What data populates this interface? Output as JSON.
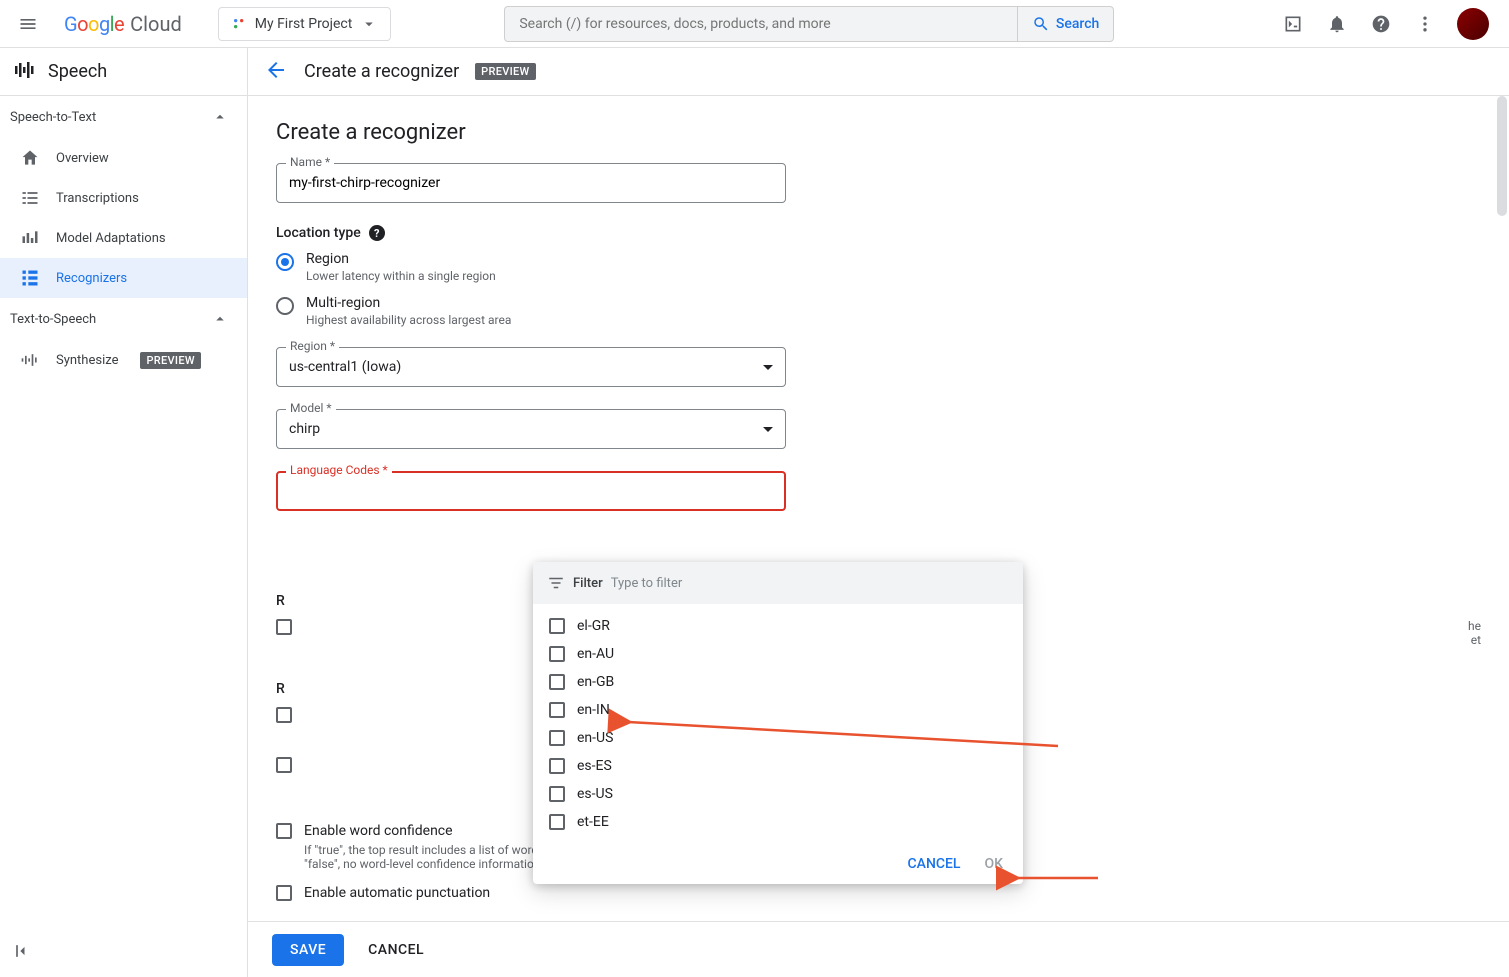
{
  "topbar": {
    "logo_text": "Google",
    "logo_cloud": "Cloud",
    "project_name": "My First Project",
    "search_placeholder": "Search (/) for resources, docs, products, and more",
    "search_button": "Search"
  },
  "product": {
    "name": "Speech",
    "page_title": "Create a recognizer",
    "badge": "PREVIEW"
  },
  "sidebar": {
    "groups": [
      {
        "label": "Speech-to-Text",
        "items": [
          {
            "label": "Overview",
            "icon": "home"
          },
          {
            "label": "Transcriptions",
            "icon": "list"
          },
          {
            "label": "Model Adaptations",
            "icon": "tune"
          },
          {
            "label": "Recognizers",
            "icon": "grid",
            "active": true
          }
        ]
      },
      {
        "label": "Text-to-Speech",
        "items": [
          {
            "label": "Synthesize",
            "icon": "wave",
            "badge": "PREVIEW"
          }
        ]
      }
    ]
  },
  "form": {
    "title": "Create a recognizer",
    "name_label": "Name *",
    "name_value": "my-first-chirp-recognizer",
    "location_type_label": "Location type",
    "radio_region_label": "Region",
    "radio_region_desc": "Lower latency within a single region",
    "radio_multi_label": "Multi-region",
    "radio_multi_desc": "Highest availability across largest area",
    "region_label": "Region *",
    "region_value": "us-central1 (Iowa)",
    "model_label": "Model *",
    "model_value": "chirp",
    "lang_label": "Language Codes *",
    "behind_r1": "R",
    "behind_r2": "R",
    "behind_partial1": "he",
    "behind_partial2": "et",
    "word_conf_label": "Enable word confidence",
    "word_conf_desc": "If \"true\", the top result includes a list of words and the confidence for those words. If \"false\", no word-level confidence information is returned.",
    "auto_punct_label": "Enable automatic punctuation"
  },
  "dropdown": {
    "filter_label": "Filter",
    "filter_placeholder": "Type to filter",
    "options": [
      "el-GR",
      "en-AU",
      "en-GB",
      "en-IN",
      "en-US",
      "es-ES",
      "es-US",
      "et-EE"
    ],
    "cancel": "CANCEL",
    "ok": "OK"
  },
  "footer": {
    "save": "SAVE",
    "cancel": "CANCEL"
  }
}
